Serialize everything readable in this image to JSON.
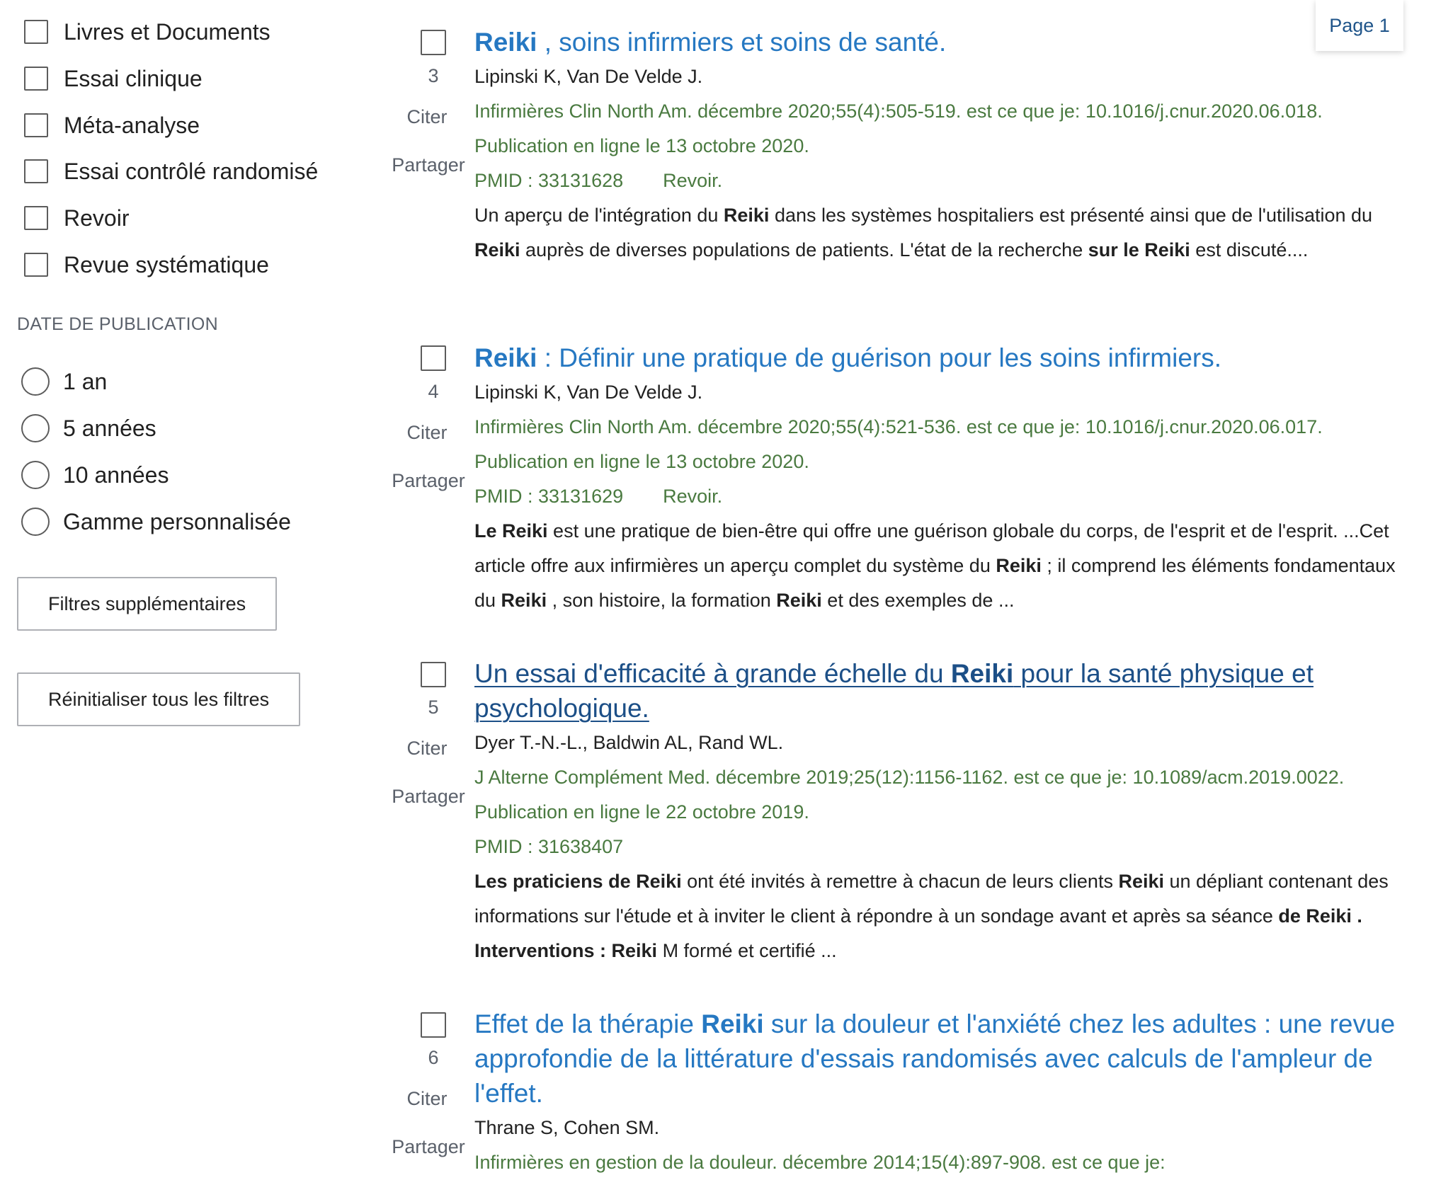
{
  "sidebar": {
    "article_types": [
      {
        "label": "Livres et Documents"
      },
      {
        "label": "Essai clinique"
      },
      {
        "label": "Méta-analyse"
      },
      {
        "label": "Essai contrôlé randomisé"
      },
      {
        "label": "Revoir"
      },
      {
        "label": "Revue systématique"
      }
    ],
    "date_heading": "DATE DE PUBLICATION",
    "date_options": [
      {
        "label": "1 an"
      },
      {
        "label": "5 années"
      },
      {
        "label": "10 années"
      },
      {
        "label": "Gamme personnalisée"
      }
    ],
    "more_filters_label": "Filtres supplémentaires",
    "reset_filters_label": "Réinitialiser tous les filtres"
  },
  "page_badge": "Page 1",
  "actions": {
    "cite": "Citer",
    "share": "Partager"
  },
  "articles": [
    {
      "number": "3",
      "title": [
        {
          "t": "Reiki",
          "b": true
        },
        {
          "t": " , soins infirmiers et soins de santé."
        }
      ],
      "authors": "Lipinski K, Van De Velde J.",
      "citation": "Infirmières Clin North Am. décembre 2020;55(4):505-519. est ce que je: 10.1016/j.cnur.2020.06.018. Publication en ligne le 13 octobre 2020.",
      "pmid": "PMID : 33131628",
      "type": "Revoir.",
      "snippet": [
        {
          "t": "Un aperçu de l'intégration du "
        },
        {
          "t": "Reiki",
          "b": true
        },
        {
          "t": " dans les systèmes hospitaliers est présenté ainsi que de l'utilisation du "
        },
        {
          "t": "Reiki",
          "b": true
        },
        {
          "t": " auprès de diverses populations de patients. L'état de la recherche "
        },
        {
          "t": "sur le Reiki",
          "b": true
        },
        {
          "t": " est discuté...."
        }
      ]
    },
    {
      "number": "4",
      "title": [
        {
          "t": "Reiki",
          "b": true
        },
        {
          "t": " : Définir une pratique de guérison pour les soins infirmiers."
        }
      ],
      "authors": "Lipinski K, Van De Velde J.",
      "citation": "Infirmières Clin North Am. décembre 2020;55(4):521-536. est ce que je: 10.1016/j.cnur.2020.06.017. Publication en ligne le 13 octobre 2020.",
      "pmid": "PMID : 33131629",
      "type": "Revoir.",
      "snippet": [
        {
          "t": "Le Reiki",
          "b": true
        },
        {
          "t": " est une pratique de bien-être qui offre une guérison globale du corps, de l'esprit et de l'esprit. ...Cet article offre aux infirmières un aperçu complet du système du "
        },
        {
          "t": "Reiki",
          "b": true
        },
        {
          "t": " ; il comprend les éléments fondamentaux du "
        },
        {
          "t": "Reiki",
          "b": true
        },
        {
          "t": " , son histoire, la formation "
        },
        {
          "t": "Reiki",
          "b": true
        },
        {
          "t": " et des exemples de ..."
        }
      ]
    },
    {
      "number": "5",
      "visited": true,
      "title": [
        {
          "t": "Un essai d'efficacité à grande échelle du "
        },
        {
          "t": "Reiki",
          "b": true
        },
        {
          "t": " pour la santé physique et psychologique."
        }
      ],
      "authors": "Dyer T.-N.-L., Baldwin AL, Rand WL.",
      "citation": "J Alterne Complément Med. décembre 2019;25(12):1156-1162. est ce que je: 10.1089/acm.2019.0022. Publication en ligne le 22 octobre 2019.",
      "pmid": "PMID : 31638407",
      "type": "",
      "snippet": [
        {
          "t": "Les praticiens de Reiki",
          "b": true
        },
        {
          "t": " ont été invités à remettre à chacun de leurs clients "
        },
        {
          "t": "Reiki",
          "b": true
        },
        {
          "t": " un dépliant contenant des informations sur l'étude et à inviter le client à répondre à un sondage avant et après sa séance "
        },
        {
          "t": "de Reiki",
          "b": true
        },
        {
          "t": " "
        },
        {
          "t": ". Interventions : Reiki",
          "b": true
        },
        {
          "t": " M formé et certifié ..."
        }
      ]
    },
    {
      "number": "6",
      "title": [
        {
          "t": "Effet de la thérapie "
        },
        {
          "t": "Reiki",
          "b": true
        },
        {
          "t": " sur la douleur et l'anxiété chez les adultes : une revue approfondie de la littérature d'essais randomisés avec calculs de l'ampleur de l'effet."
        }
      ],
      "authors": "Thrane S, Cohen SM.",
      "citation": "Infirmières en gestion de la douleur. décembre 2014;15(4):897-908. est ce que je:",
      "pmid": "",
      "type": "",
      "snippet": []
    }
  ]
}
